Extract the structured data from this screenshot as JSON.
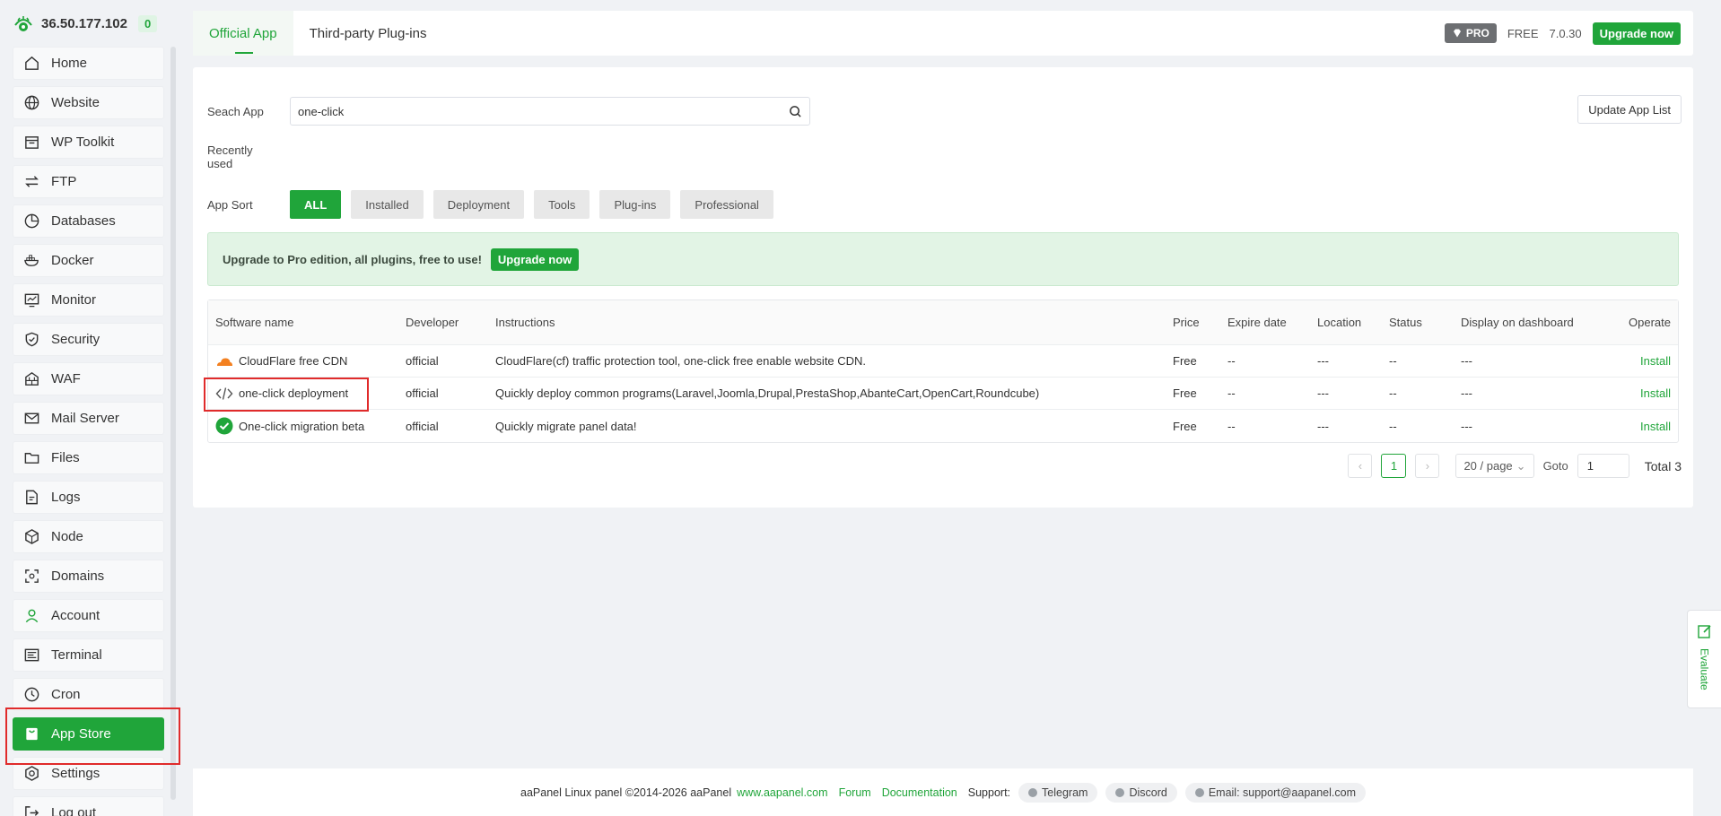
{
  "header": {
    "ip": "36.50.177.102",
    "alert_count": "0"
  },
  "sidebar": {
    "items": [
      {
        "label": "Home"
      },
      {
        "label": "Website"
      },
      {
        "label": "WP Toolkit"
      },
      {
        "label": "FTP"
      },
      {
        "label": "Databases"
      },
      {
        "label": "Docker"
      },
      {
        "label": "Monitor"
      },
      {
        "label": "Security"
      },
      {
        "label": "WAF"
      },
      {
        "label": "Mail Server"
      },
      {
        "label": "Files"
      },
      {
        "label": "Logs"
      },
      {
        "label": "Node"
      },
      {
        "label": "Domains"
      },
      {
        "label": "Account"
      },
      {
        "label": "Terminal"
      },
      {
        "label": "Cron"
      },
      {
        "label": "App Store"
      },
      {
        "label": "Settings"
      },
      {
        "label": "Log out"
      }
    ]
  },
  "tabs": {
    "official": "Official App",
    "third_party": "Third-party Plug-ins"
  },
  "topright": {
    "pro": "PRO",
    "free": "FREE",
    "version": "7.0.30",
    "upgrade": "Upgrade now"
  },
  "search": {
    "label": "Seach App",
    "value": "one-click"
  },
  "update_btn": "Update App List",
  "recently_used": "Recently used",
  "sort": {
    "label": "App Sort",
    "options": [
      "ALL",
      "Installed",
      "Deployment",
      "Tools",
      "Plug-ins",
      "Professional"
    ],
    "selected": "ALL"
  },
  "banner": {
    "text": "Upgrade to Pro edition, all plugins, free to use!",
    "button": "Upgrade now"
  },
  "table": {
    "headers": [
      "Software name",
      "Developer",
      "Instructions",
      "Price",
      "Expire date",
      "Location",
      "Status",
      "Display on dashboard",
      "Operate"
    ],
    "rows": [
      {
        "name": "CloudFlare free CDN",
        "developer": "official",
        "instructions": "CloudFlare(cf) traffic protection tool, one-click free enable website CDN.",
        "price": "Free",
        "expire": "--",
        "location": "---",
        "status": "--",
        "display": "---",
        "operate": "Install"
      },
      {
        "name": "one-click deployment",
        "developer": "official",
        "instructions": "Quickly deploy common programs(Laravel,Joomla,Drupal,PrestaShop,AbanteCart,OpenCart,Roundcube)",
        "price": "Free",
        "expire": "--",
        "location": "---",
        "status": "--",
        "display": "---",
        "operate": "Install"
      },
      {
        "name": "One-click migration beta",
        "developer": "official",
        "instructions": "Quickly migrate panel data!",
        "price": "Free",
        "expire": "--",
        "location": "---",
        "status": "--",
        "display": "---",
        "operate": "Install"
      }
    ]
  },
  "pagination": {
    "page": "1",
    "page_size": "20 / page",
    "goto_label": "Goto",
    "goto_value": "1",
    "total": "Total 3"
  },
  "evaluate": "Evaluate",
  "footer": {
    "copyright": "aaPanel Linux panel ©2014-2026 aaPanel",
    "site": "www.aapanel.com",
    "forum": "Forum",
    "docs": "Documentation",
    "support": "Support:",
    "telegram": "Telegram",
    "discord": "Discord",
    "email": "Email: support@aapanel.com"
  },
  "colors": {
    "accent": "#20a53a",
    "highlight": "#e02b2b"
  }
}
